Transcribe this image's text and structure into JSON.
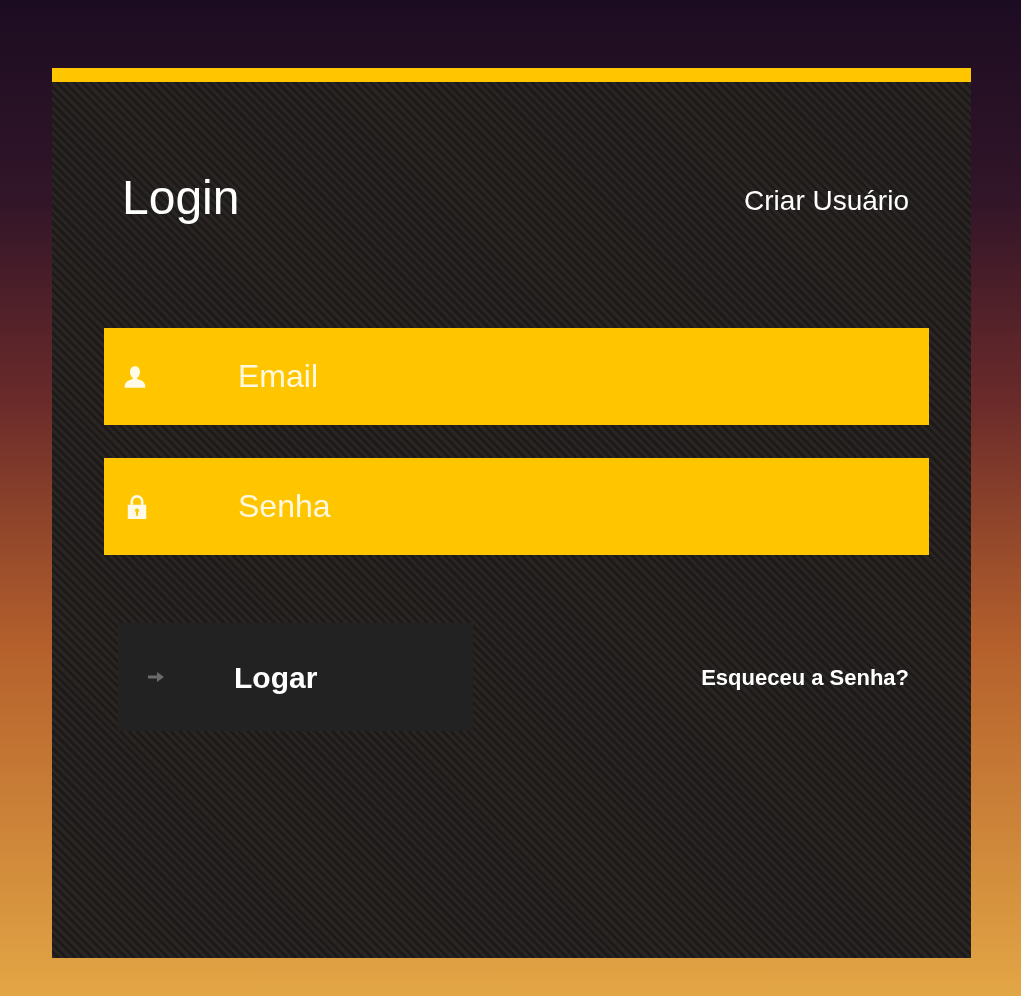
{
  "title": "Login",
  "create_user_link": "Criar Usuário",
  "fields": [
    {
      "kind": "email",
      "placeholder": "Email"
    },
    {
      "kind": "password",
      "placeholder": "Senha"
    }
  ],
  "submit_button": "Logar",
  "forgot_link": "Esqueceu a Senha?"
}
